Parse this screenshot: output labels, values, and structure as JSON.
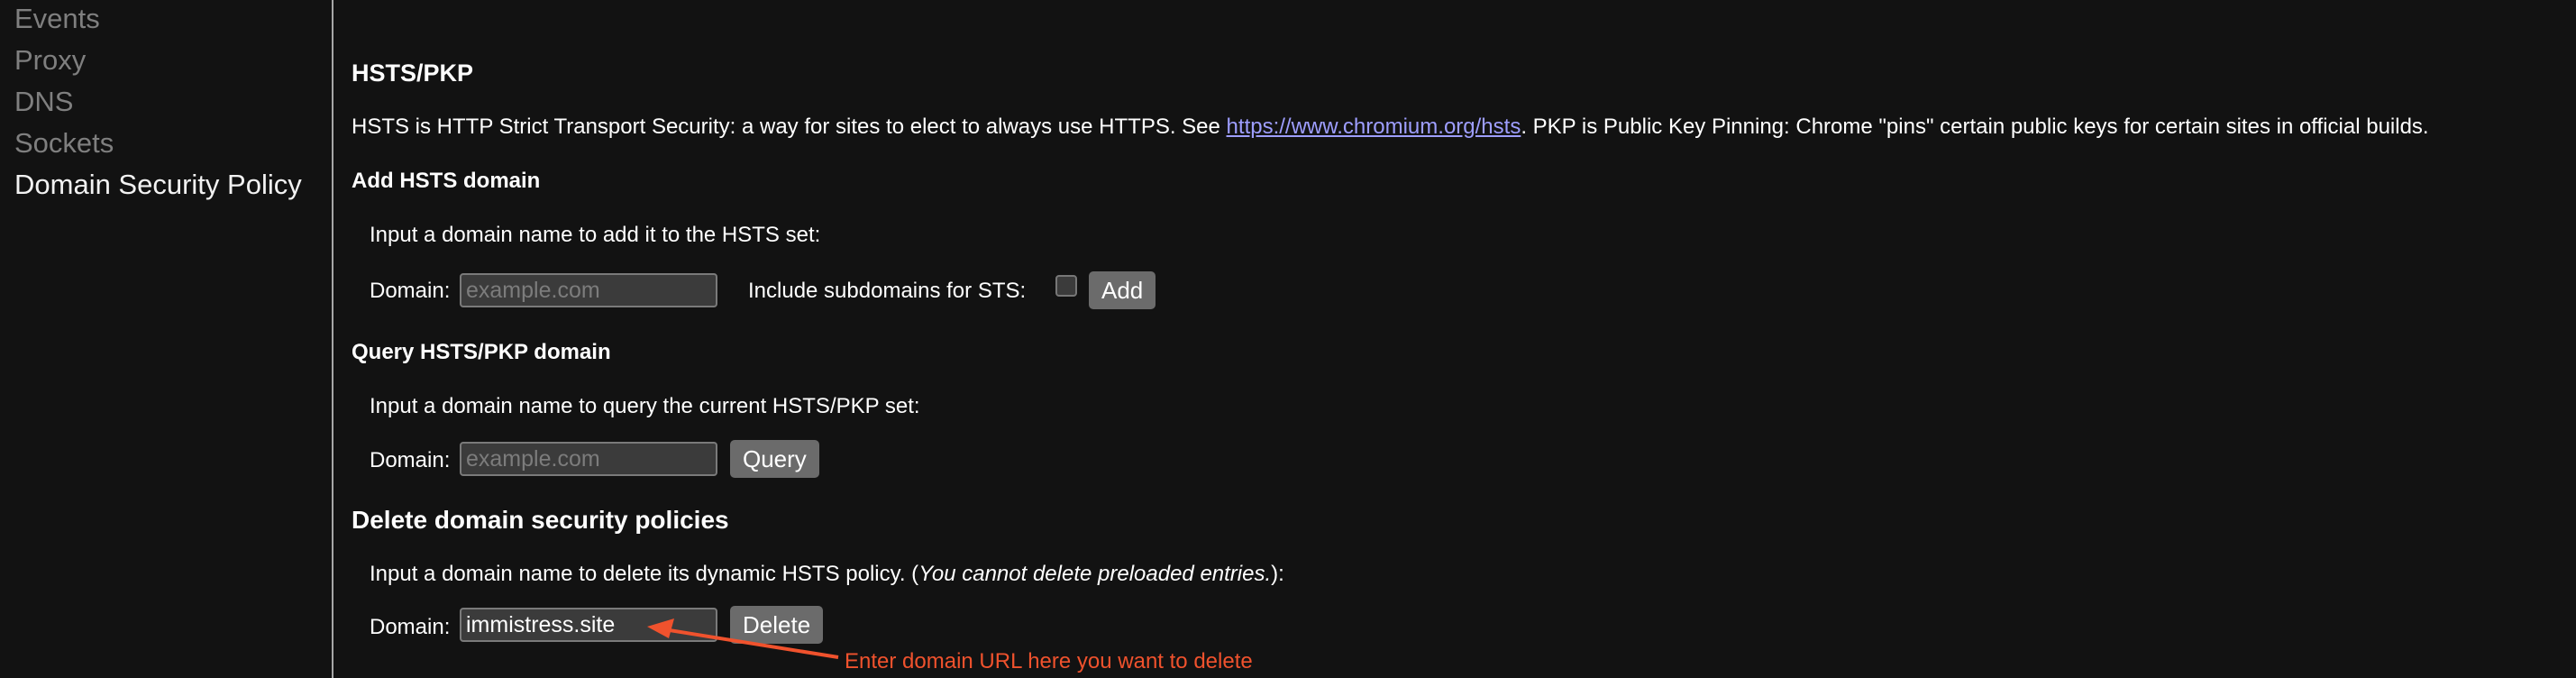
{
  "sidebar": {
    "items": [
      {
        "label": "Events",
        "active": false
      },
      {
        "label": "Proxy",
        "active": false
      },
      {
        "label": "DNS",
        "active": false
      },
      {
        "label": "Sockets",
        "active": false
      },
      {
        "label": "Domain Security Policy",
        "active": true
      }
    ]
  },
  "main": {
    "title": "HSTS/PKP",
    "description": {
      "before_link": "HSTS is HTTP Strict Transport Security: a way for sites to elect to always use HTTPS. See ",
      "link_text": "https://www.chromium.org/hsts",
      "after_link": ". PKP is Public Key Pinning: Chrome \"pins\" certain public keys for certain sites in official builds."
    },
    "add_section": {
      "title": "Add HSTS domain",
      "instruction": "Input a domain name to add it to the HSTS set:",
      "domain_label": "Domain:",
      "domain_placeholder": "example.com",
      "domain_value": "",
      "subdomains_label": "Include subdomains for STS:",
      "subdomains_checked": false,
      "button_label": "Add"
    },
    "query_section": {
      "title": "Query HSTS/PKP domain",
      "instruction": "Input a domain name to query the current HSTS/PKP set:",
      "domain_label": "Domain:",
      "domain_placeholder": "example.com",
      "domain_value": "",
      "button_label": "Query"
    },
    "delete_section": {
      "title": "Delete domain security policies",
      "instruction_before": "Input a domain name to delete its dynamic HSTS policy. (",
      "instruction_italic": "You cannot delete preloaded entries.",
      "instruction_after": "):",
      "domain_label": "Domain:",
      "domain_value": "immistress.site",
      "button_label": "Delete"
    }
  },
  "annotation": {
    "text": "Enter domain URL here you want to delete",
    "color": "#f0522d"
  },
  "colors": {
    "background": "#121212",
    "link": "#9e9eff",
    "sidebar_inactive": "#7f7f7f",
    "button_bg": "#6b6b6b",
    "input_bg": "#3b3b3b"
  }
}
